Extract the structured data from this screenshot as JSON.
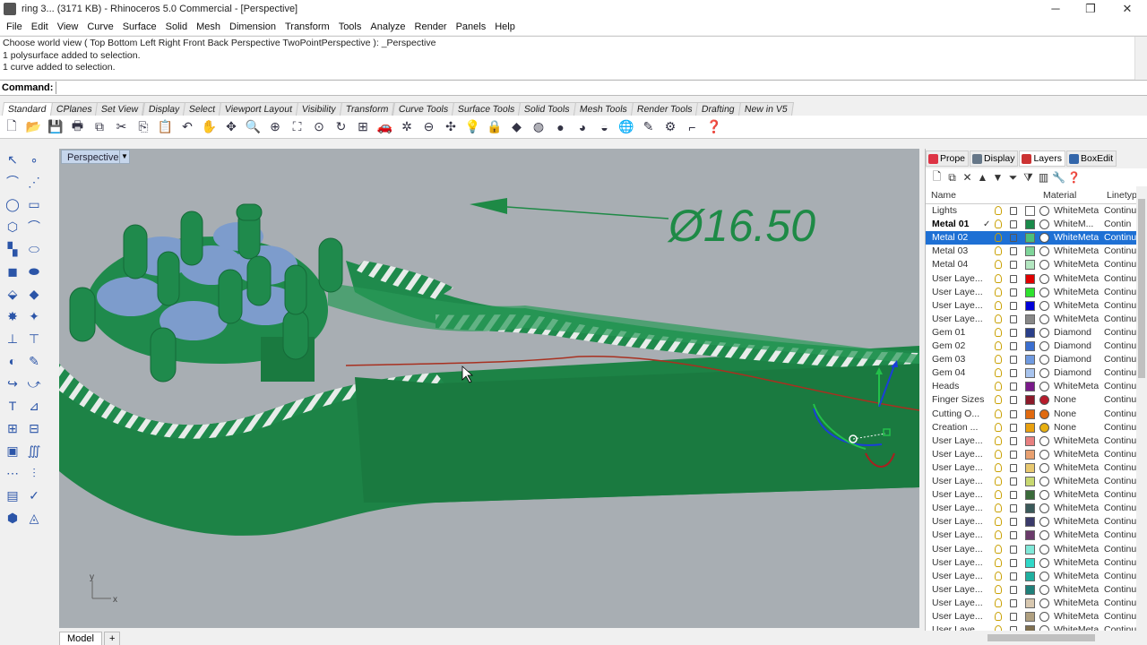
{
  "window": {
    "title": "ring 3... (3171 KB) - Rhinoceros 5.0 Commercial - [Perspective]",
    "minimize": "─",
    "maximize": "❐",
    "close": "✕"
  },
  "menu": [
    "File",
    "Edit",
    "View",
    "Curve",
    "Surface",
    "Solid",
    "Mesh",
    "Dimension",
    "Transform",
    "Tools",
    "Analyze",
    "Render",
    "Panels",
    "Help"
  ],
  "history": [
    "Choose world view ( Top  Bottom  Left  Right  Front  Back  Perspective  TwoPointPerspective ): _Perspective",
    "1 polysurface added to selection.",
    "1 curve added to selection."
  ],
  "command": {
    "label": "Command:",
    "value": ""
  },
  "toolbar_tabs": [
    "Standard",
    "CPlanes",
    "Set View",
    "Display",
    "Select",
    "Viewport Layout",
    "Visibility",
    "Transform",
    "Curve Tools",
    "Surface Tools",
    "Solid Tools",
    "Mesh Tools",
    "Render Tools",
    "Drafting",
    "New in V5"
  ],
  "toolbar_icons": [
    {
      "name": "new-icon",
      "glyph": "🗋"
    },
    {
      "name": "open-icon",
      "glyph": "📂"
    },
    {
      "name": "save-icon",
      "glyph": "💾"
    },
    {
      "name": "print-icon",
      "glyph": "🖶"
    },
    {
      "name": "import-icon",
      "glyph": "⧉"
    },
    {
      "name": "cut-icon",
      "glyph": "✂"
    },
    {
      "name": "copy-icon",
      "glyph": "⎘"
    },
    {
      "name": "paste-icon",
      "glyph": "📋"
    },
    {
      "name": "undo-icon",
      "glyph": "↶"
    },
    {
      "name": "pan-icon",
      "glyph": "✋"
    },
    {
      "name": "rotate-view-icon",
      "glyph": "✥"
    },
    {
      "name": "zoom-icon",
      "glyph": "🔍"
    },
    {
      "name": "zoom-window-icon",
      "glyph": "⊕"
    },
    {
      "name": "zoom-extents-icon",
      "glyph": "⛶"
    },
    {
      "name": "zoom-selected-icon",
      "glyph": "⊙"
    },
    {
      "name": "rotate-icon",
      "glyph": "↻"
    },
    {
      "name": "four-view-icon",
      "glyph": "⊞"
    },
    {
      "name": "car-icon",
      "glyph": "🚗"
    },
    {
      "name": "snapshot-icon",
      "glyph": "✲"
    },
    {
      "name": "cplane-icon",
      "glyph": "⊖"
    },
    {
      "name": "gumball-icon",
      "glyph": "✣"
    },
    {
      "name": "light-icon",
      "glyph": "💡"
    },
    {
      "name": "lock-icon",
      "glyph": "🔒"
    },
    {
      "name": "layer-icon",
      "glyph": "◆"
    },
    {
      "name": "color-wheel-icon",
      "glyph": "◍"
    },
    {
      "name": "render-sphere-icon",
      "glyph": "●"
    },
    {
      "name": "shaded-sphere-icon",
      "glyph": "◕"
    },
    {
      "name": "ghosted-sphere-icon",
      "glyph": "◒"
    },
    {
      "name": "globe-icon",
      "glyph": "🌐"
    },
    {
      "name": "properties-icon",
      "glyph": "✎"
    },
    {
      "name": "options-icon",
      "glyph": "⚙"
    },
    {
      "name": "dimension-icon",
      "glyph": "⌐"
    },
    {
      "name": "help-icon",
      "glyph": "❓"
    }
  ],
  "viewport": {
    "title": "Perspective",
    "dimension_text": "Ø16.50",
    "axis_x": "x",
    "axis_y": "y"
  },
  "bottom_tabs": [
    "Model",
    "+"
  ],
  "panel_tabs": [
    {
      "label": "Prope",
      "color": "#d34"
    },
    {
      "label": "Display",
      "color": "#678"
    },
    {
      "label": "Layers",
      "color": "#c33"
    },
    {
      "label": "BoxEdit",
      "color": "#36a"
    }
  ],
  "panel_tools": [
    "🗋",
    "⧉",
    "✕",
    "▲",
    "▼",
    "⏷",
    "⧩",
    "▥",
    "🔧",
    "❓"
  ],
  "layer_headers": {
    "name": "Name",
    "material": "Material",
    "linetype": "Linetyp"
  },
  "layers": [
    {
      "name": "Lights",
      "current": false,
      "selected": false,
      "color": "#ffffff",
      "material": "WhiteMetal",
      "mcolor": "#ffffff",
      "linetype": "Continu"
    },
    {
      "name": "Metal 01",
      "current": true,
      "selected": false,
      "color": "#1a8a4a",
      "material": "WhiteM...",
      "mcolor": "#ffffff",
      "linetype": "Contin"
    },
    {
      "name": "Metal 02",
      "current": false,
      "selected": true,
      "color": "#4cc079",
      "material": "WhiteMetal",
      "mcolor": "#ffffff",
      "linetype": "Continu"
    },
    {
      "name": "Metal 03",
      "current": false,
      "selected": false,
      "color": "#7fd59a",
      "material": "WhiteMetal",
      "mcolor": "#ffffff",
      "linetype": "Continu"
    },
    {
      "name": "Metal 04",
      "current": false,
      "selected": false,
      "color": "#b3e6c0",
      "material": "WhiteMetal",
      "mcolor": "#ffffff",
      "linetype": "Continu"
    },
    {
      "name": "User Laye...",
      "current": false,
      "selected": false,
      "color": "#e00000",
      "material": "WhiteMetal",
      "mcolor": "#ffffff",
      "linetype": "Continu"
    },
    {
      "name": "User Laye...",
      "current": false,
      "selected": false,
      "color": "#2fe22f",
      "material": "WhiteMetal",
      "mcolor": "#ffffff",
      "linetype": "Continu"
    },
    {
      "name": "User Laye...",
      "current": false,
      "selected": false,
      "color": "#0000d8",
      "material": "WhiteMetal",
      "mcolor": "#ffffff",
      "linetype": "Continu"
    },
    {
      "name": "User Laye...",
      "current": false,
      "selected": false,
      "color": "#888888",
      "material": "WhiteMetal",
      "mcolor": "#ffffff",
      "linetype": "Continu"
    },
    {
      "name": "Gem 01",
      "current": false,
      "selected": false,
      "color": "#2a3f8a",
      "material": "Diamond",
      "mcolor": "#ffffff",
      "linetype": "Continu"
    },
    {
      "name": "Gem 02",
      "current": false,
      "selected": false,
      "color": "#3b6fd0",
      "material": "Diamond",
      "mcolor": "#ffffff",
      "linetype": "Continu"
    },
    {
      "name": "Gem 03",
      "current": false,
      "selected": false,
      "color": "#6f9ae0",
      "material": "Diamond",
      "mcolor": "#ffffff",
      "linetype": "Continu"
    },
    {
      "name": "Gem 04",
      "current": false,
      "selected": false,
      "color": "#a8c4ee",
      "material": "Diamond",
      "mcolor": "#ffffff",
      "linetype": "Continu"
    },
    {
      "name": "Heads",
      "current": false,
      "selected": false,
      "color": "#7a1a8a",
      "material": "WhiteMetal",
      "mcolor": "#ffffff",
      "linetype": "Continu"
    },
    {
      "name": "Finger Sizes",
      "current": false,
      "selected": false,
      "color": "#8b1a2a",
      "material": "None",
      "mcolor": "#b81c2c",
      "linetype": "Continu"
    },
    {
      "name": "Cutting O...",
      "current": false,
      "selected": false,
      "color": "#e06a10",
      "material": "None",
      "mcolor": "#e06a10",
      "linetype": "Continu"
    },
    {
      "name": "Creation ...",
      "current": false,
      "selected": false,
      "color": "#e8a010",
      "material": "None",
      "mcolor": "#e8b010",
      "linetype": "Continu"
    },
    {
      "name": "User Laye...",
      "current": false,
      "selected": false,
      "color": "#e88080",
      "material": "WhiteMetal",
      "mcolor": "#ffffff",
      "linetype": "Continu"
    },
    {
      "name": "User Laye...",
      "current": false,
      "selected": false,
      "color": "#e8a070",
      "material": "WhiteMetal",
      "mcolor": "#ffffff",
      "linetype": "Continu"
    },
    {
      "name": "User Laye...",
      "current": false,
      "selected": false,
      "color": "#e8c870",
      "material": "WhiteMetal",
      "mcolor": "#ffffff",
      "linetype": "Continu"
    },
    {
      "name": "User Laye...",
      "current": false,
      "selected": false,
      "color": "#c8d870",
      "material": "WhiteMetal",
      "mcolor": "#ffffff",
      "linetype": "Continu"
    },
    {
      "name": "User Laye...",
      "current": false,
      "selected": false,
      "color": "#3a6a3a",
      "material": "WhiteMetal",
      "mcolor": "#ffffff",
      "linetype": "Continu"
    },
    {
      "name": "User Laye...",
      "current": false,
      "selected": false,
      "color": "#3a5a5a",
      "material": "WhiteMetal",
      "mcolor": "#ffffff",
      "linetype": "Continu"
    },
    {
      "name": "User Laye...",
      "current": false,
      "selected": false,
      "color": "#3a3a6a",
      "material": "WhiteMetal",
      "mcolor": "#ffffff",
      "linetype": "Continu"
    },
    {
      "name": "User Laye...",
      "current": false,
      "selected": false,
      "color": "#6a3a6a",
      "material": "WhiteMetal",
      "mcolor": "#ffffff",
      "linetype": "Continu"
    },
    {
      "name": "User Laye...",
      "current": false,
      "selected": false,
      "color": "#80e8d8",
      "material": "WhiteMetal",
      "mcolor": "#ffffff",
      "linetype": "Continu"
    },
    {
      "name": "User Laye...",
      "current": false,
      "selected": false,
      "color": "#30d8c8",
      "material": "WhiteMetal",
      "mcolor": "#ffffff",
      "linetype": "Continu"
    },
    {
      "name": "User Laye...",
      "current": false,
      "selected": false,
      "color": "#20b0a0",
      "material": "WhiteMetal",
      "mcolor": "#ffffff",
      "linetype": "Continu"
    },
    {
      "name": "User Laye...",
      "current": false,
      "selected": false,
      "color": "#20807a",
      "material": "WhiteMetal",
      "mcolor": "#ffffff",
      "linetype": "Continu"
    },
    {
      "name": "User Laye...",
      "current": false,
      "selected": false,
      "color": "#d8c8b0",
      "material": "WhiteMetal",
      "mcolor": "#ffffff",
      "linetype": "Continu"
    },
    {
      "name": "User Laye...",
      "current": false,
      "selected": false,
      "color": "#b0a080",
      "material": "WhiteMetal",
      "mcolor": "#ffffff",
      "linetype": "Continu"
    },
    {
      "name": "User Laye...",
      "current": false,
      "selected": false,
      "color": "#807050",
      "material": "WhiteMetal",
      "mcolor": "#ffffff",
      "linetype": "Continu"
    }
  ],
  "colors": {
    "ring_green": "#1f8a4c",
    "ring_dark": "#156a38",
    "gem_blue": "#7d9ccc",
    "viewport_bg": "#a8aeb3",
    "selection_blue": "#1e70d4"
  }
}
